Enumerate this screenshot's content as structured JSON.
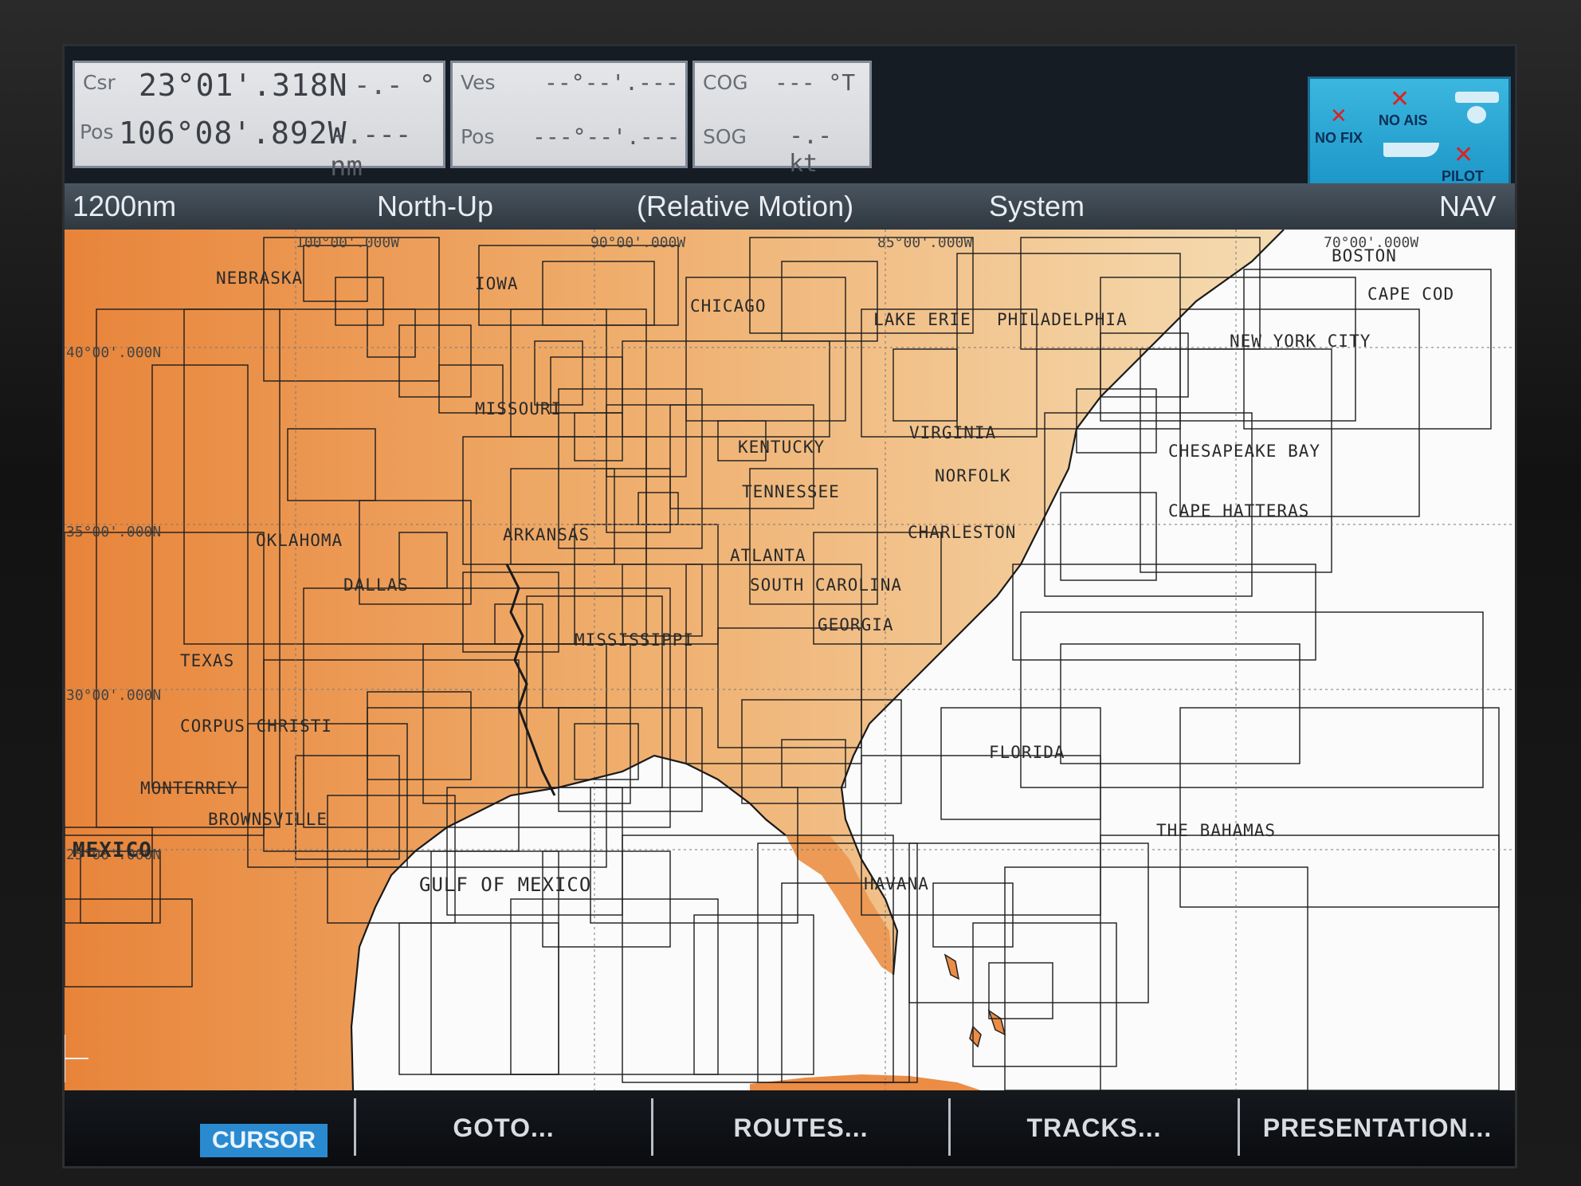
{
  "readouts": {
    "csr": {
      "label": "Csr",
      "lat": "23°01'.318N",
      "bearing": "-.- °"
    },
    "pos": {
      "label": "Pos",
      "lon": "106°08'.892W",
      "range": "-.--- nm"
    },
    "ves": {
      "label": "Ves",
      "value": "--°--'.---"
    },
    "ves_pos": {
      "label": "Pos",
      "value": "---°--'.---"
    },
    "cog": {
      "label": "COG",
      "value": "--- °T"
    },
    "sog": {
      "label": "SOG",
      "value": "-.- kt"
    }
  },
  "status": {
    "no_fix": "NO FIX",
    "no_ais": "NO AIS",
    "pilot": "PILOT"
  },
  "modebar": {
    "range": "1200nm",
    "orientation": "North-Up",
    "motion": "(Relative Motion)",
    "system": "System",
    "nav": "NAV"
  },
  "map": {
    "gridlabels": {
      "lon100": "100°00'.000W",
      "lon90": "90°00'.000W",
      "lon85": "85°00'.000W",
      "lon70": "70°00'.000W",
      "lat40": "40°00'.000N",
      "lat35": "35°00'.000N",
      "lat30": "30°00'.000N",
      "lat25": "25°00'.000N"
    },
    "places": {
      "nebraska": "NEBRASKA",
      "iowa": "IOWA",
      "chicago": "CHICAGO",
      "lake_erie": "LAKE ERIE",
      "philadelphia": "PHILADELPHIA",
      "boston": "BOSTON",
      "cape_cod": "CAPE COD",
      "new_york": "NEW YORK CITY",
      "missouri": "MISSOURI",
      "kentucky": "KENTUCKY",
      "virginia": "VIRGINIA",
      "norfolk": "NORFOLK",
      "chesapeake": "CHESAPEAKE BAY",
      "tennessee": "TENNESSEE",
      "cape_hatteras": "CAPE HATTERAS",
      "oklahoma": "OKLAHOMA",
      "arkansas": "ARKANSAS",
      "charleston": "CHARLESTON",
      "atlanta": "ATLANTA",
      "dallas": "DALLAS",
      "south_carolina": "SOUTH CAROLINA",
      "georgia": "GEORGIA",
      "mississippi": "MISSISSIPPI",
      "texas": "TEXAS",
      "corpus": "CORPUS CHRISTI",
      "florida": "FLORIDA",
      "monterrey": "MONTERREY",
      "brownsville": "BROWNSVILLE",
      "bahamas": "THE BAHAMAS",
      "mexico": "MEXICO",
      "gulf": "GULF OF MEXICO",
      "havana": "HAVANA"
    }
  },
  "softkeys": {
    "cursor": "CURSOR",
    "goto": "GOTO...",
    "routes": "ROUTES...",
    "tracks": "TRACKS...",
    "presentation": "PRESENTATION..."
  },
  "colors": {
    "land_dark": "#e8843a",
    "land_light": "#f3d4a6",
    "water": "#fbfbfb",
    "accent": "#2a8ad0"
  }
}
